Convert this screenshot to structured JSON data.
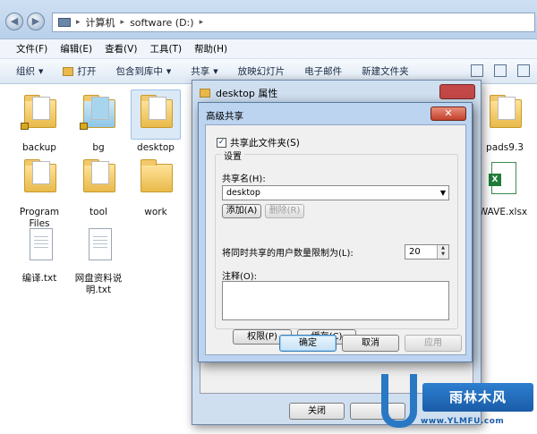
{
  "address": {
    "segments": [
      "计算机",
      "software (D:)"
    ]
  },
  "menu": [
    "文件(F)",
    "编辑(E)",
    "查看(V)",
    "工具(T)",
    "帮助(H)"
  ],
  "commands": [
    {
      "label": "组织",
      "dropdown": true
    },
    {
      "label": "打开",
      "dropdown": false
    },
    {
      "label": "包含到库中",
      "dropdown": true
    },
    {
      "label": "共享",
      "dropdown": true
    },
    {
      "label": "放映幻灯片",
      "dropdown": false
    },
    {
      "label": "电子邮件",
      "dropdown": false
    },
    {
      "label": "新建文件夹",
      "dropdown": false
    }
  ],
  "files": [
    {
      "name": "backup",
      "type": "folder"
    },
    {
      "name": "bg",
      "type": "folder"
    },
    {
      "name": "desktop",
      "type": "folder"
    },
    {
      "name": "pads9.3",
      "type": "folder"
    },
    {
      "name": "Program Files",
      "type": "folder"
    },
    {
      "name": "tool",
      "type": "folder"
    },
    {
      "name": "work",
      "type": "folder"
    },
    {
      "name": "WAVE.xlsx",
      "type": "xlsx"
    },
    {
      "name": "编译.txt",
      "type": "txt"
    },
    {
      "name": "网盘资料说明.txt",
      "type": "txt"
    }
  ],
  "properties_window": {
    "title": "desktop 属性",
    "footer": {
      "close": "关闭"
    }
  },
  "advanced_sharing": {
    "title": "高级共享",
    "share_checkbox": "共享此文件夹(S)",
    "share_checked": true,
    "settings_group": "设置",
    "share_name_label": "共享名(H):",
    "share_name_value": "desktop",
    "add_button": "添加(A)",
    "remove_button": "删除(R)",
    "user_limit_label": "将同时共享的用户数量限制为(L):",
    "user_limit_value": "20",
    "comments_label": "注释(O):",
    "permissions_button": "权限(P)",
    "caching_button": "缓存(C)",
    "ok_button": "确定",
    "cancel_button": "取消",
    "apply_button": "应用"
  },
  "watermark": {
    "brand": "雨林木风",
    "url": "www.YLMFU.com"
  }
}
